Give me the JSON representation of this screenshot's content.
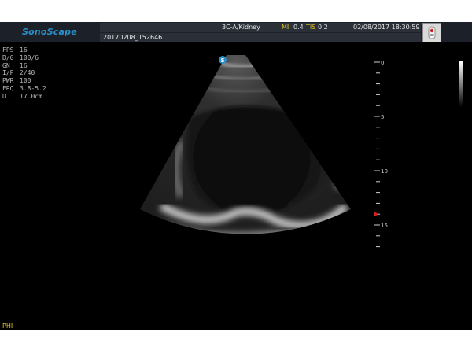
{
  "header": {
    "brand": "SonoScape",
    "probe_preset": "3C-A/Kidney",
    "mi_label": "MI",
    "mi_value": "0.4",
    "tis_label": "TIS",
    "tis_value": "0.2",
    "datetime": "02/08/2017 18:30:59",
    "exam_id": "20170208_152646"
  },
  "params": [
    {
      "key": "FPS",
      "value": "16"
    },
    {
      "key": "D/G",
      "value": "100/6"
    },
    {
      "key": "GN",
      "value": "16"
    },
    {
      "key": "I/P",
      "value": "2/40"
    },
    {
      "key": "PWR",
      "value": "100"
    },
    {
      "key": "FRQ",
      "value": "3.8-5.2"
    },
    {
      "key": "D",
      "value": "17.0cm"
    }
  ],
  "depth_scale": {
    "max_cm": 17,
    "labels": [
      "0",
      "5",
      "10",
      "15"
    ],
    "focus_depth_cm": 14
  },
  "orientation_marker": "S",
  "footer": {
    "mode_label": "PHI"
  },
  "colors": {
    "brand": "#2a8fc9",
    "param_highlight": "#e6c62a",
    "focus_marker": "#e02020",
    "orientation_marker": "#2a8fc9"
  }
}
